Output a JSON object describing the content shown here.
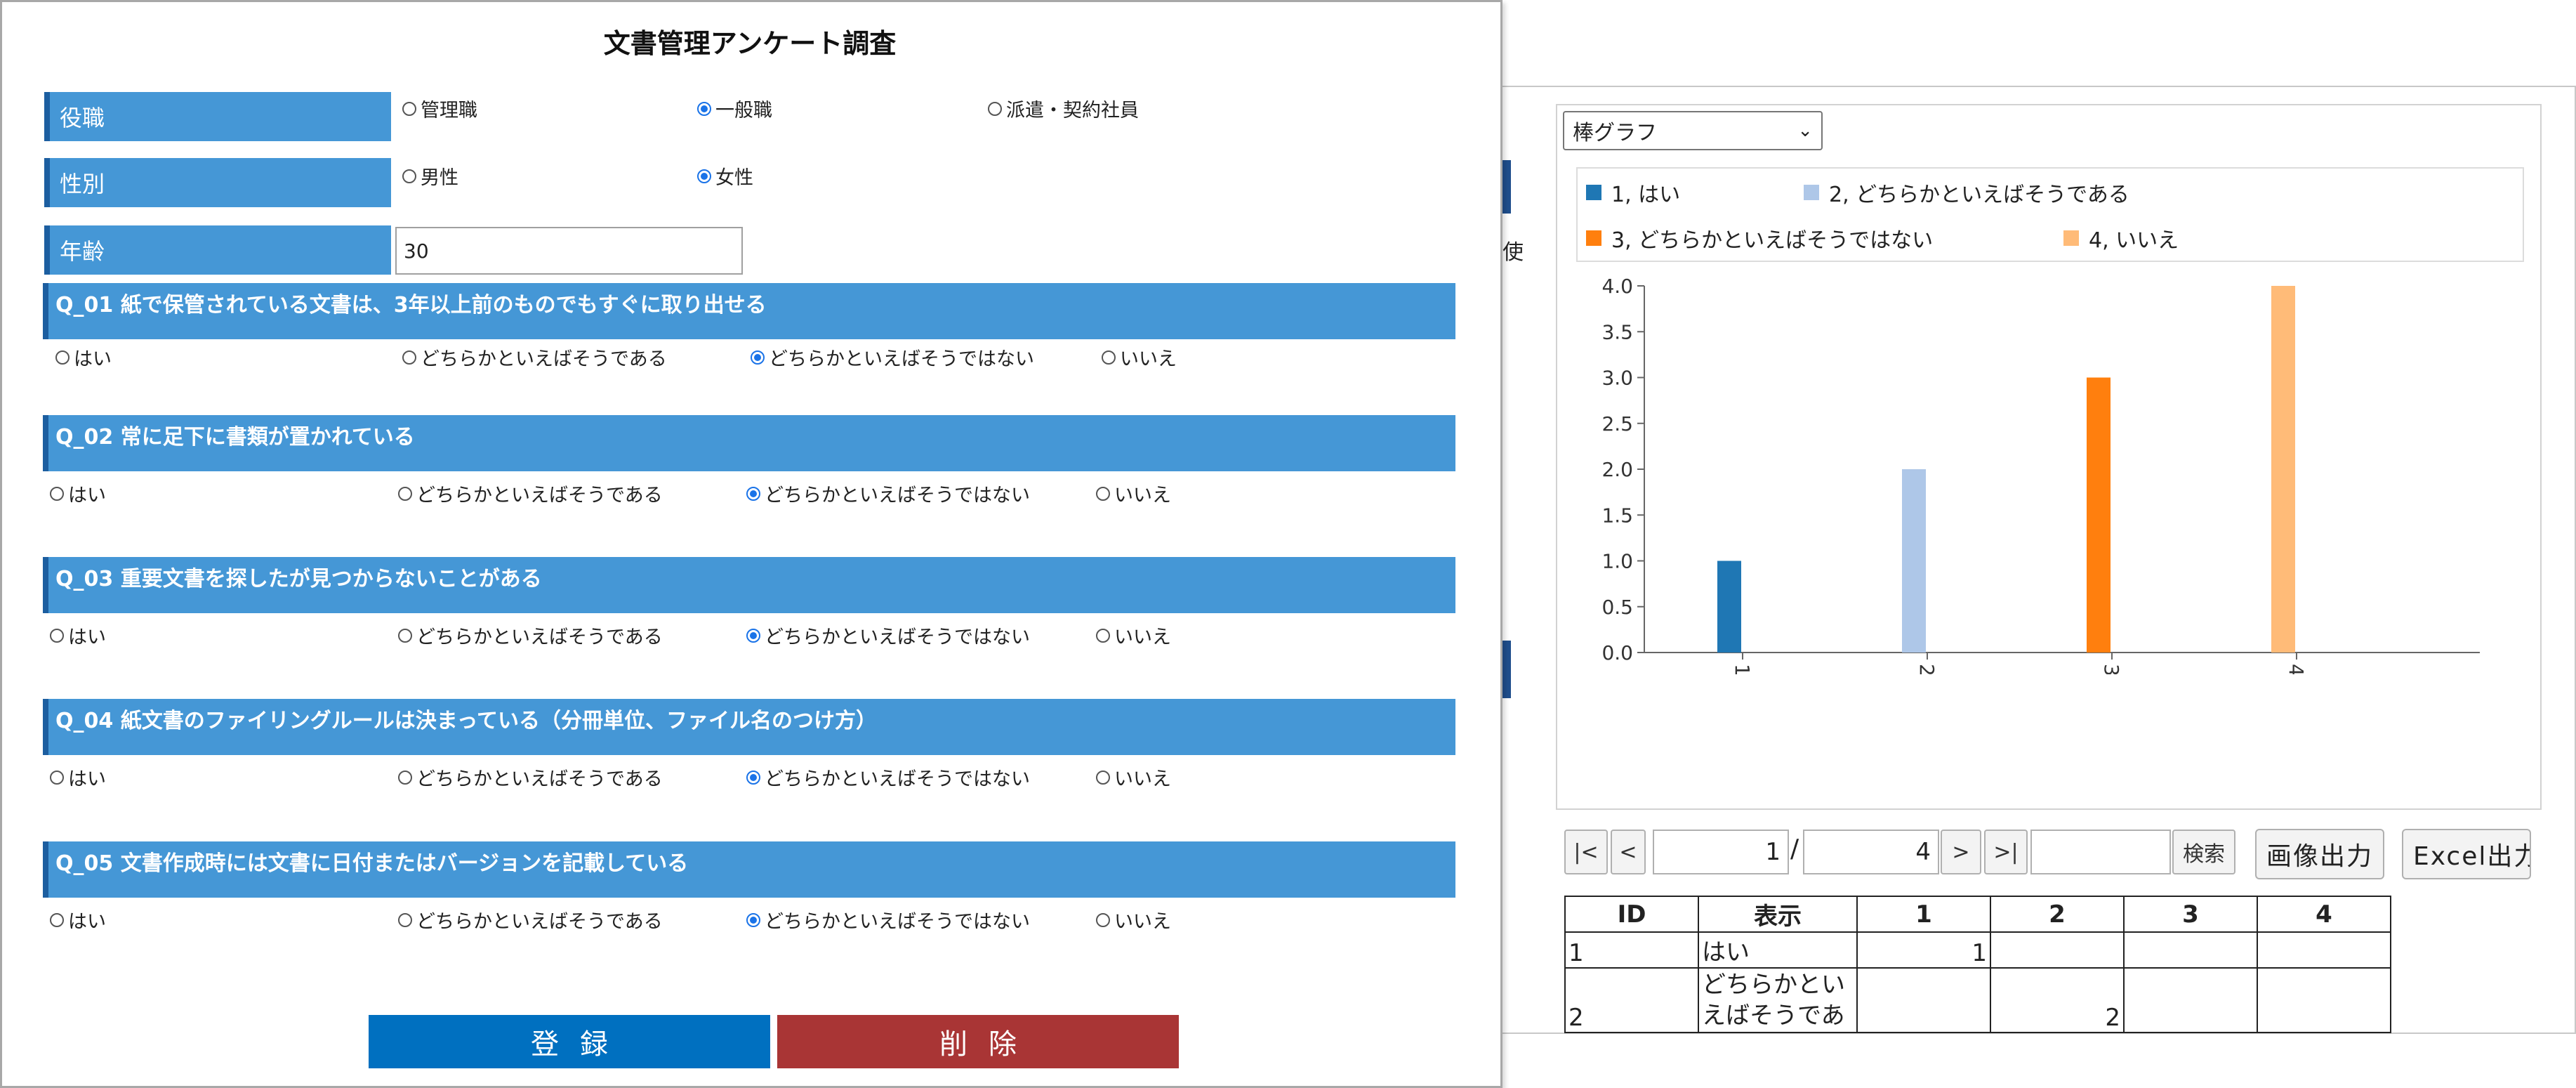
{
  "form": {
    "title": "文書管理アンケート調査",
    "role": {
      "label": "役職",
      "options": [
        "管理職",
        "一般職",
        "派遣・契約社員"
      ],
      "selected": 1
    },
    "gender": {
      "label": "性別",
      "options": [
        "男性",
        "女性"
      ],
      "selected": 1
    },
    "age": {
      "label": "年齢",
      "value": "30"
    },
    "questions": [
      {
        "label": "Q_01 紙で保管されている文書は、3年以上前のものでもすぐに取り出せる",
        "selected": 2
      },
      {
        "label": "Q_02 常に足下に書類が置かれている",
        "selected": 2
      },
      {
        "label": "Q_03 重要文書を探したが見つからないことがある",
        "selected": 2
      },
      {
        "label": "Q_04 紙文書のファイリングルールは決まっている（分冊単位、ファイル名のつけ方）",
        "selected": 2
      },
      {
        "label": "Q_05 文書作成時には文書に日付またはバージョンを記載している",
        "selected": 2
      }
    ],
    "answer_options": [
      "はい",
      "どちらかといえばそうである",
      "どちらかといえばそうではない",
      "いいえ"
    ],
    "register_label": "登録",
    "delete_label": "削除",
    "colors": {
      "label_bg": "#4597d6",
      "register": "#0070c0",
      "delete": "#a93535"
    }
  },
  "chart_panel": {
    "chart_type_value": "棒グラフ",
    "partial_text": "使",
    "pager": {
      "first": "|<",
      "prev": "<",
      "current_page": "1",
      "separator": "/",
      "total_pages": "4",
      "next": ">",
      "last": ">|",
      "search_value": "",
      "search": "検索"
    },
    "image_export": "画像出力",
    "excel_export": "Excel出力",
    "table": {
      "headers": [
        "ID",
        "表示",
        "1",
        "2",
        "3",
        "4"
      ],
      "rows": [
        [
          "1",
          "はい",
          "1",
          "",
          "",
          ""
        ],
        [
          "2",
          "どちらかといえばそうであ",
          "",
          "2",
          "",
          ""
        ]
      ]
    }
  },
  "chart_data": {
    "type": "bar",
    "categories": [
      "1",
      "2",
      "3",
      "4"
    ],
    "series": [
      {
        "name": "1, はい",
        "values": [
          1.0,
          null,
          null,
          null
        ],
        "color": "#1f77b4"
      },
      {
        "name": "2, どちらかといえばそうである",
        "values": [
          null,
          2.0,
          null,
          null
        ],
        "color": "#aec7e8"
      },
      {
        "name": "3, どちらかといえばそうではない",
        "values": [
          null,
          null,
          3.0,
          null
        ],
        "color": "#ff7f0e"
      },
      {
        "name": "4, いいえ",
        "values": [
          null,
          null,
          null,
          4.0
        ],
        "color": "#ffbb78"
      }
    ],
    "yticks": [
      "0.0",
      "0.5",
      "1.0",
      "1.5",
      "2.0",
      "2.5",
      "3.0",
      "3.5",
      "4.0"
    ],
    "ylim": [
      0,
      4
    ],
    "legend": "top",
    "grid": false
  }
}
